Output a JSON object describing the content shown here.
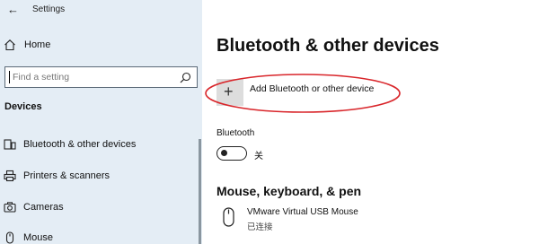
{
  "window": {
    "title": "Settings"
  },
  "sidebar": {
    "home_label": "Home",
    "search": {
      "placeholder": "Find a setting"
    },
    "section_label": "Devices",
    "items": [
      {
        "label": "Bluetooth & other devices",
        "icon": "bluetooth-devices-icon"
      },
      {
        "label": "Printers & scanners",
        "icon": "printer-icon"
      },
      {
        "label": "Cameras",
        "icon": "camera-icon"
      },
      {
        "label": "Mouse",
        "icon": "mouse-icon"
      }
    ]
  },
  "main": {
    "title": "Bluetooth & other devices",
    "add_device_label": "Add Bluetooth or other device",
    "bluetooth": {
      "heading": "Bluetooth",
      "state_label": "关",
      "enabled": false
    },
    "mouse_section": {
      "heading": "Mouse, keyboard, & pen",
      "devices": [
        {
          "name": "VMware Virtual USB Mouse",
          "status": "已连接"
        }
      ]
    }
  },
  "colors": {
    "sidebar_bg": "#e4edf5",
    "annotation": "#d9262b",
    "tile": "#dddddd"
  }
}
